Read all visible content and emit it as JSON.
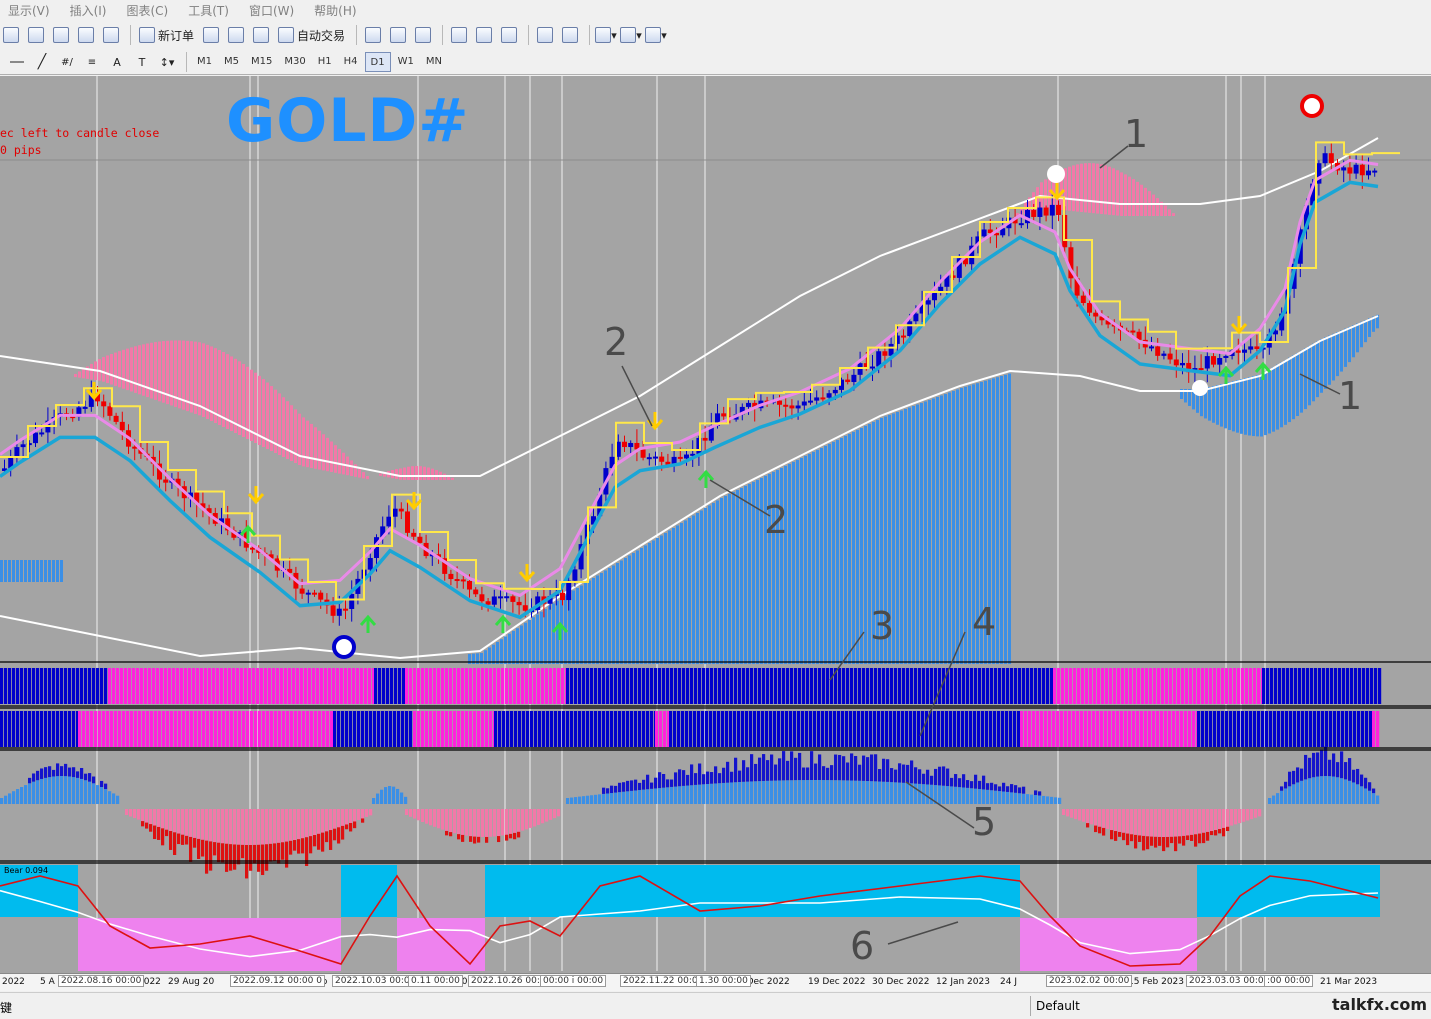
{
  "menu": [
    "显示(V)",
    "插入(I)",
    "图表(C)",
    "工具(T)",
    "窗口(W)",
    "帮助(H)"
  ],
  "toolbar": {
    "new_order_label": "新订单",
    "auto_trade_label": "自动交易",
    "timeframes": [
      "M1",
      "M5",
      "M15",
      "M30",
      "H1",
      "H4",
      "D1",
      "W1",
      "MN"
    ],
    "active_timeframe": "D1",
    "text_tool": "A",
    "text_label_tool": "T"
  },
  "chart": {
    "symbol": "GOLD#",
    "timer_text": "ec left to candle close",
    "pips_text": "0 pips",
    "indicator_label": "Bear 0.094",
    "background_color": "#a4a4a4",
    "bull_color": "#0000cc",
    "bear_color": "#ee0000"
  },
  "annotations": [
    "1",
    "1",
    "2",
    "2",
    "3",
    "4",
    "5",
    "6"
  ],
  "time_axis": {
    "labels": [
      "2022",
      "5 A",
      "2022",
      "29 Aug 20",
      "20 Sep",
      "20",
      "7 Dec 2022",
      "19 Dec 2022",
      "30 Dec 2022",
      "12 Jan 2023",
      "24 J",
      "023",
      "15 Feb 2023",
      "21 Mar 2023"
    ],
    "boxed": [
      "2022.08.16 00:00",
      "2022.09.12 00:00 0",
      "2022.10.03 00:00",
      "0.11 00:00",
      "2022.10.26 00:00",
      "00:00 i 00:00",
      "2022.11.22 00:00",
      "1.30 00:00",
      "2023.02.02 00:00",
      "2023.03.03 00:00",
      ":00 00:00"
    ]
  },
  "status": {
    "left": "键",
    "profile": "Default",
    "watermark": "talkfx.com"
  }
}
